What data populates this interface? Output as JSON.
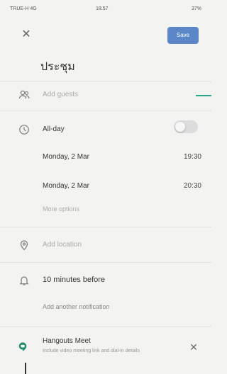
{
  "status_bar": {
    "carrier": "TRUE-H 4G",
    "time": "18:57",
    "battery": "37%"
  },
  "header": {
    "close_icon": "close-icon",
    "save_label": "Save",
    "title": "ประชุม"
  },
  "guests": {
    "icon": "people-icon",
    "placeholder": "Add guests"
  },
  "all_day": {
    "icon": "clock-icon",
    "label": "All-day",
    "toggle_on": false
  },
  "start": {
    "date": "Monday, 2 Mar",
    "time": "19:30"
  },
  "end": {
    "date": "Monday, 2 Mar",
    "time": "20:30"
  },
  "more_options": "More options",
  "location": {
    "icon": "location-icon",
    "placeholder": "Add location"
  },
  "notification": {
    "icon": "bell-icon",
    "label": "10 minutes before",
    "add_label": "Add another notification"
  },
  "hangouts": {
    "icon": "hangouts-icon",
    "title": "Hangouts Meet",
    "description": "Include video meeting link and dial-in details",
    "dismiss_icon": "close-icon"
  },
  "colors": {
    "accent": "#5b87c8",
    "green": "#27a78a",
    "hangouts": "#1e8e6e"
  }
}
